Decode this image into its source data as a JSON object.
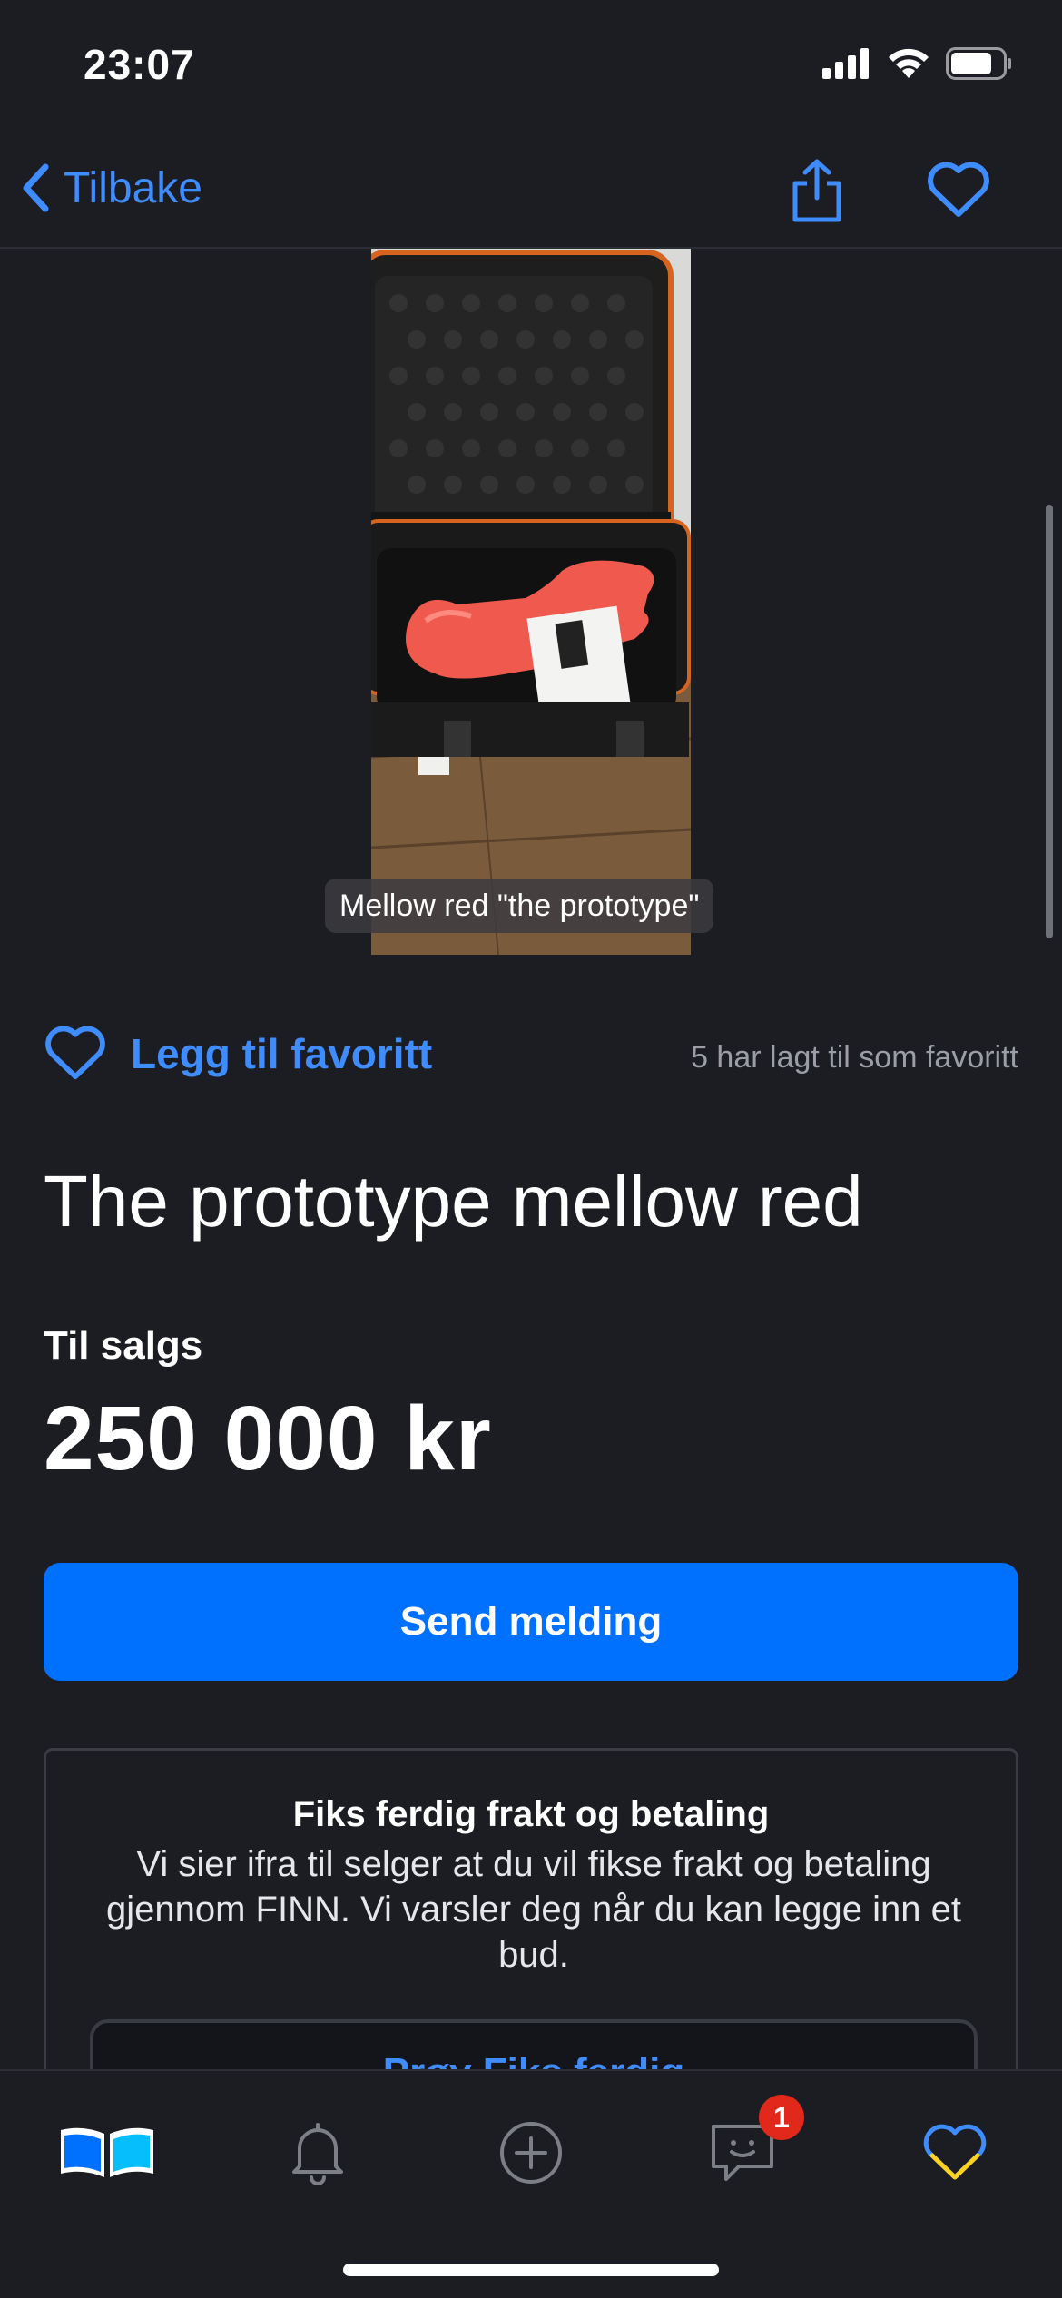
{
  "status_bar": {
    "time": "23:07"
  },
  "nav": {
    "back_label": "Tilbake"
  },
  "gallery": {
    "caption": "Mellow red \"the prototype\""
  },
  "favorite": {
    "label": "Legg til favoritt",
    "count_text": "5 har lagt til som favoritt"
  },
  "listing": {
    "title": "The prototype mellow red",
    "sale_type": "Til salgs",
    "price": "250 000 kr"
  },
  "send_button": {
    "label": "Send melding"
  },
  "fiks_ferdig": {
    "title": "Fiks ferdig frakt og betaling",
    "body": "Vi sier ifra til selger at du vil fikse frakt og betaling gjennom FINN. Vi varsler deg når du kan legge inn et bud.",
    "button_label": "Prøv Fiks ferdig"
  },
  "tab_bar": {
    "items": [
      {
        "icon": "market-book-icon"
      },
      {
        "icon": "bell-icon"
      },
      {
        "icon": "plus-circle-icon"
      },
      {
        "icon": "chat-icon",
        "badge": "1"
      },
      {
        "icon": "heart-icon"
      }
    ]
  },
  "colors": {
    "accent": "#3f8cff",
    "primary_button": "#0070ff",
    "background": "#1c1d23",
    "badge": "#e2281b"
  }
}
